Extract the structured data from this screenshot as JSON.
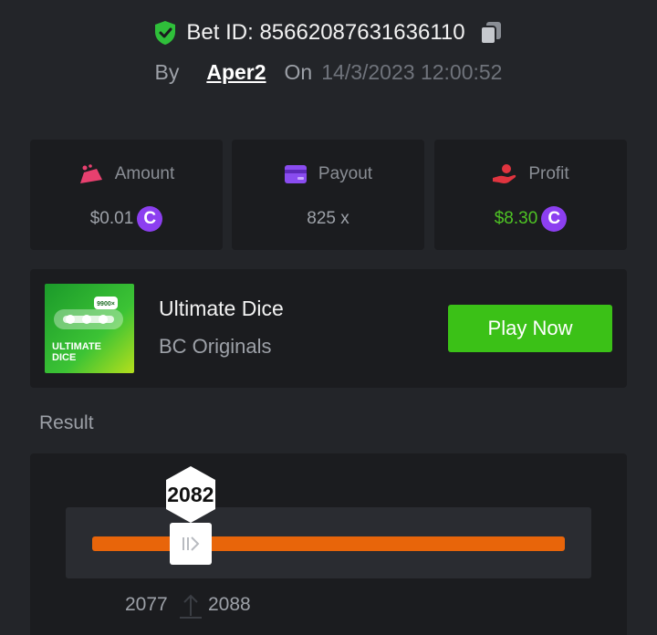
{
  "bet": {
    "id_label": "Bet ID: 85662087631636110",
    "by_label": "By",
    "user": "Aper2",
    "on_label": "On",
    "timestamp": "14/3/2023 12:00:52"
  },
  "stats": {
    "amount": {
      "label": "Amount",
      "value": "$0.01",
      "coin": "C"
    },
    "payout": {
      "label": "Payout",
      "value": "825 x"
    },
    "profit": {
      "label": "Profit",
      "value": "$8.30",
      "coin": "C"
    }
  },
  "game": {
    "title": "Ultimate Dice",
    "subtitle": "BC Originals",
    "play_label": "Play Now",
    "thumb_title_line1": "ULTIMATE",
    "thumb_title_line2": "DICE",
    "thumb_badge": "9900×"
  },
  "result": {
    "label": "Result",
    "value": "2082",
    "range_low": "2077",
    "range_high": "2088",
    "position_fraction": 0.2082
  },
  "colors": {
    "accent_green": "#3bc117",
    "profit_green": "#4ec324",
    "coin_purple": "#8c3ff0",
    "bar_orange": "#e8650a",
    "amount_icon": "#e8406f",
    "payout_icon": "#8a4cf0",
    "profit_icon": "#e0343f"
  }
}
